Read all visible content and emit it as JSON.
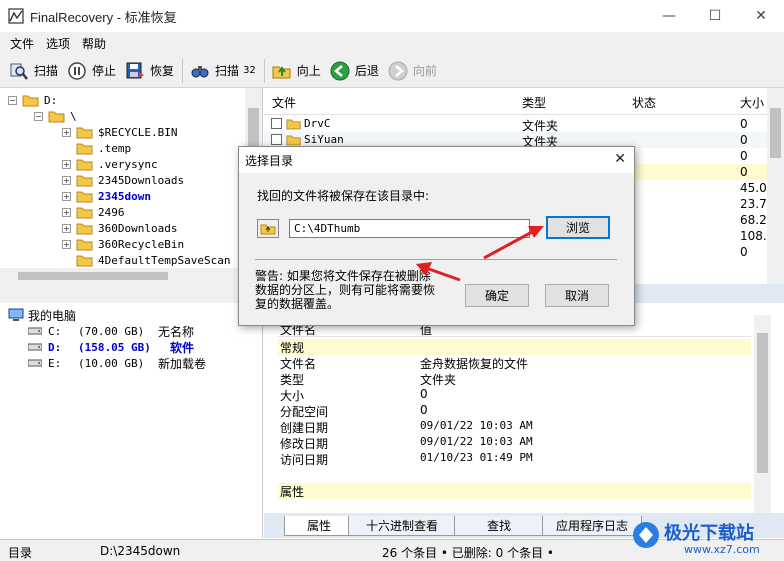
{
  "window": {
    "title": "FinalRecovery - 标准恢复",
    "minimize_glyph": "—",
    "maximize_glyph": "☐",
    "close_glyph": "✕"
  },
  "menu": [
    "文件",
    "选项",
    "帮助"
  ],
  "toolbar": {
    "scan": "扫描",
    "stop": "停止",
    "restore": "恢复",
    "scan32": "扫描",
    "scan32_badge": "32",
    "up": "向上",
    "back": "后退",
    "forward": "向前"
  },
  "tree": {
    "root": "D:",
    "child": "\\",
    "items": [
      {
        "name": "$RECYCLE.BIN",
        "expandable": true
      },
      {
        "name": ".temp",
        "expandable": false
      },
      {
        "name": ".verysync",
        "expandable": true
      },
      {
        "name": "2345Downloads",
        "expandable": true
      },
      {
        "name": "2345down",
        "expandable": true,
        "selected": true
      },
      {
        "name": "2496",
        "expandable": true
      },
      {
        "name": "360Downloads",
        "expandable": true
      },
      {
        "name": "360RecycleBin",
        "expandable": true
      },
      {
        "name": "4DefaultTempSaveScan",
        "expandable": false
      }
    ]
  },
  "drives": {
    "root": "我的电脑",
    "list": [
      {
        "letter": "C:",
        "size": "(70.00 GB)",
        "label": "无名称",
        "selected": false
      },
      {
        "letter": "D:",
        "size": "(158.05 GB)",
        "label": "软件",
        "selected": true
      },
      {
        "letter": "E:",
        "size": "(10.00 GB)",
        "label": "新加载卷",
        "selected": false
      }
    ]
  },
  "filelist": {
    "columns": [
      "文件",
      "类型",
      "状态",
      "大小"
    ],
    "rows": [
      {
        "name": "DrvC",
        "type": "文件夹",
        "size": "0"
      },
      {
        "name": "SiYuan",
        "type": "文件夹",
        "size": "0"
      },
      {
        "name": "",
        "type": "",
        "size": "0"
      },
      {
        "name": "",
        "type": "",
        "size": "0"
      },
      {
        "name": "",
        "type": "",
        "size": "45.0"
      },
      {
        "name": "",
        "type": "",
        "size": "23.7"
      },
      {
        "name": "",
        "type": "",
        "size": "68.2"
      },
      {
        "name": "",
        "type": "",
        "size": "108."
      },
      {
        "name": "",
        "type": "",
        "size": "0"
      }
    ]
  },
  "properties": {
    "header_key": "文件名",
    "header_value": "值",
    "section_general": "常规",
    "rows": [
      {
        "k": "文件名",
        "v": "金舟数据恢复的文件"
      },
      {
        "k": "类型",
        "v": "文件夹"
      },
      {
        "k": "大小",
        "v": "0"
      },
      {
        "k": "分配空间",
        "v": "0"
      },
      {
        "k": "创建日期",
        "v": "09/01/22 10:03 AM"
      },
      {
        "k": "修改日期",
        "v": "09/01/22 10:03 AM"
      },
      {
        "k": "访问日期",
        "v": "01/10/23 01:49 PM"
      }
    ],
    "section_attr": "属性"
  },
  "tabs": [
    "属性",
    "十六进制查看",
    "查找",
    "应用程序日志"
  ],
  "statusbar": {
    "label": "目录",
    "path": "D:\\2345down",
    "count": "26 个条目 • 已删除: 0 个条目 •"
  },
  "dialog": {
    "title": "选择目录",
    "prompt": "找回的文件将被保存在该目录中:",
    "path": "C:\\4DThumb",
    "browse": "浏览",
    "warning": "警告: 如果您将文件保存在被删除数据的分区上，则有可能将需要恢复的数据覆盖。",
    "ok": "确定",
    "cancel": "取消"
  },
  "watermark": {
    "brand": "极光下载站",
    "url": "www.xz7.com"
  },
  "colors": {
    "selection_text": "#0000cc",
    "highlight_row": "#fffbd0",
    "tab_strip": "#dfe8f3",
    "arrow_red": "#e02020",
    "default_button_border": "#0078d7"
  }
}
